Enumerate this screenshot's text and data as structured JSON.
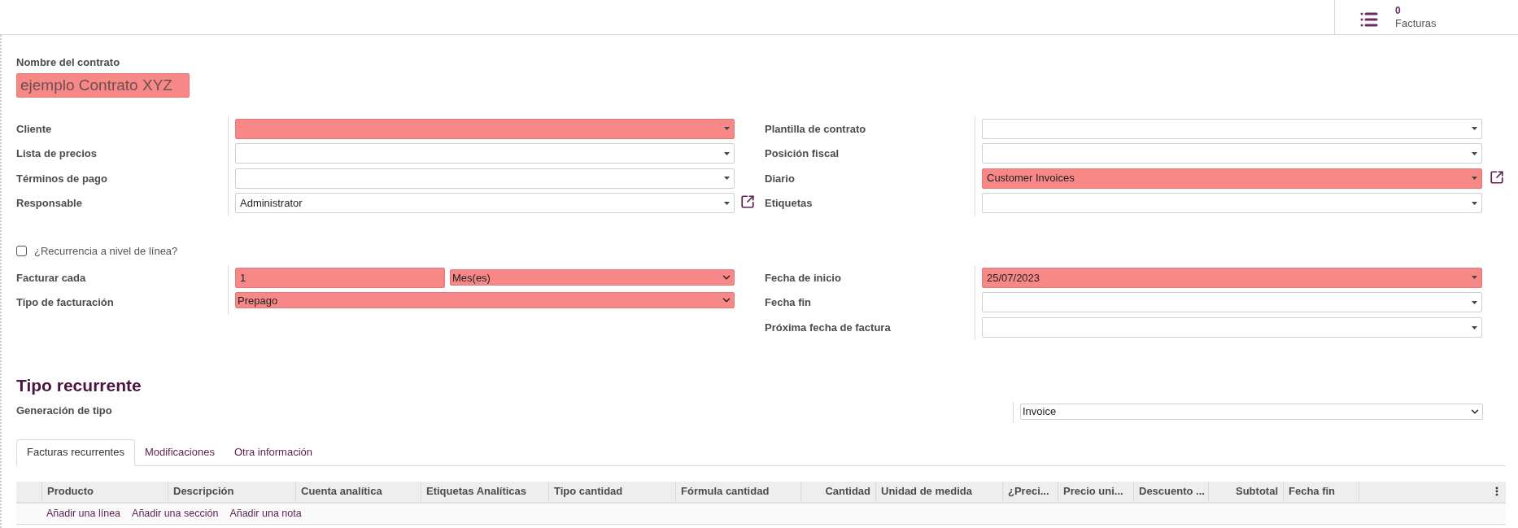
{
  "stat_button": {
    "count": "0",
    "label": "Facturas"
  },
  "contract_name": {
    "label": "Nombre del contrato",
    "placeholder": "ejemplo Contrato XYZ",
    "required": true
  },
  "group_1": {
    "left": [
      {
        "label": "Cliente",
        "kind": "many2one",
        "required": true,
        "external_link": false
      },
      {
        "label": "Lista de precios",
        "kind": "many2one",
        "required": false,
        "external_link": false
      },
      {
        "label": "Términos de pago",
        "kind": "many2one",
        "required": false,
        "external_link": false
      },
      {
        "label": "Responsable",
        "kind": "many2one",
        "value": "Administrator",
        "required": false,
        "external_link": true
      }
    ],
    "right": [
      {
        "label": "Plantilla de contrato",
        "kind": "many2one",
        "required": false,
        "external_link": false
      },
      {
        "label": "Posición fiscal",
        "kind": "many2one",
        "required": false,
        "external_link": false
      },
      {
        "label": "Diario",
        "kind": "many2one",
        "value": "Customer Invoices",
        "required": true,
        "external_link": true
      },
      {
        "label": "Etiquetas",
        "kind": "many2one",
        "required": false,
        "external_link": false
      }
    ]
  },
  "recurrence_checkbox": {
    "label": "¿Recurrencia a nivel de línea?",
    "checked": false
  },
  "group_2": {
    "left": [
      {
        "label": "Facturar cada",
        "kind": "interval",
        "value": "1",
        "unit": "Mes(es)",
        "required": true,
        "external_link": false
      },
      {
        "label": "Tipo de facturación",
        "kind": "select",
        "value": "Prepago",
        "required": true,
        "external_link": false
      }
    ],
    "right": [
      {
        "label": "Fecha de inicio",
        "kind": "date",
        "value": "25/07/2023",
        "required": true,
        "external_link": false
      },
      {
        "label": "Fecha fin",
        "kind": "date",
        "required": false,
        "external_link": false
      },
      {
        "label": "Próxima fecha de factura",
        "kind": "date",
        "required": false,
        "external_link": false
      }
    ]
  },
  "section": {
    "title": "Tipo recurrente",
    "field": {
      "label": "Generación de tipo",
      "kind": "select",
      "value": "Invoice",
      "required": false
    }
  },
  "tabs": [
    {
      "label": "Facturas recurrentes",
      "selected": true
    },
    {
      "label": "Modificaciones",
      "selected": false
    },
    {
      "label": "Otra información",
      "selected": false
    }
  ],
  "table": {
    "columns": [
      {
        "label": "Producto",
        "numeric": false
      },
      {
        "label": "Descripción",
        "numeric": false
      },
      {
        "label": "Cuenta analítica",
        "numeric": false
      },
      {
        "label": "Etiquetas Analíticas",
        "numeric": false
      },
      {
        "label": "Tipo cantidad",
        "numeric": false
      },
      {
        "label": "Fórmula cantidad",
        "numeric": false
      },
      {
        "label": "Cantidad",
        "numeric": true
      },
      {
        "label": "Unidad de medida",
        "numeric": false
      },
      {
        "label": "¿Preci...",
        "numeric": false
      },
      {
        "label": "Precio uni...",
        "numeric": false
      },
      {
        "label": "Descuento ...",
        "numeric": false
      },
      {
        "label": "Subtotal",
        "numeric": true
      },
      {
        "label": "Fecha fin",
        "numeric": false
      }
    ],
    "add_links": [
      "Añadir una línea",
      "Añadir una sección",
      "Añadir una nota"
    ]
  }
}
